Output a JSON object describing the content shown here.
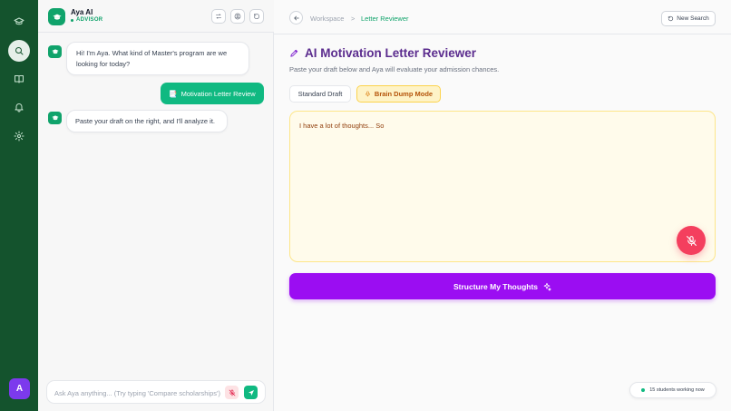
{
  "rail": {
    "icons": [
      "graduation-cap-icon",
      "search-icon",
      "book-icon",
      "bell-icon",
      "gear-icon"
    ],
    "active": "search-icon",
    "avatar_initial": "A"
  },
  "chat": {
    "assistant_name": "Aya AI",
    "assistant_role": "ADVISOR",
    "messages": [
      {
        "from": "assistant",
        "text": "Hi! I'm Aya. What kind of Master's program are we looking for today?"
      },
      {
        "from": "user",
        "text": "Motivation Letter Review",
        "icon": "📑"
      },
      {
        "from": "assistant",
        "text": "Paste your draft on the right, and I'll analyze it."
      }
    ],
    "input_placeholder": "Ask Aya anything... (Try typing 'Compare scholarships')"
  },
  "main": {
    "breadcrumb": [
      "Workspace",
      "Letter Reviewer"
    ],
    "breadcrumb_separator": ">",
    "new_search_label": "New Search",
    "title": "AI Motivation Letter Reviewer",
    "subtitle": "Paste your draft below and Aya will evaluate your admission chances.",
    "modes": {
      "standard": "Standard Draft",
      "brain_dump": "Brain Dump Mode",
      "active": "brain_dump"
    },
    "draft_text": "I have a lot of thoughts... So",
    "structure_button": "Structure My Thoughts",
    "online_status": "15 students working now"
  },
  "colors": {
    "rail": "#14532d",
    "accent_green": "#10b981",
    "purple": "#9b0df2",
    "title_purple": "#5b2c8e",
    "amber_bg": "#fffbeb",
    "mic_red": "#f43f5e"
  }
}
